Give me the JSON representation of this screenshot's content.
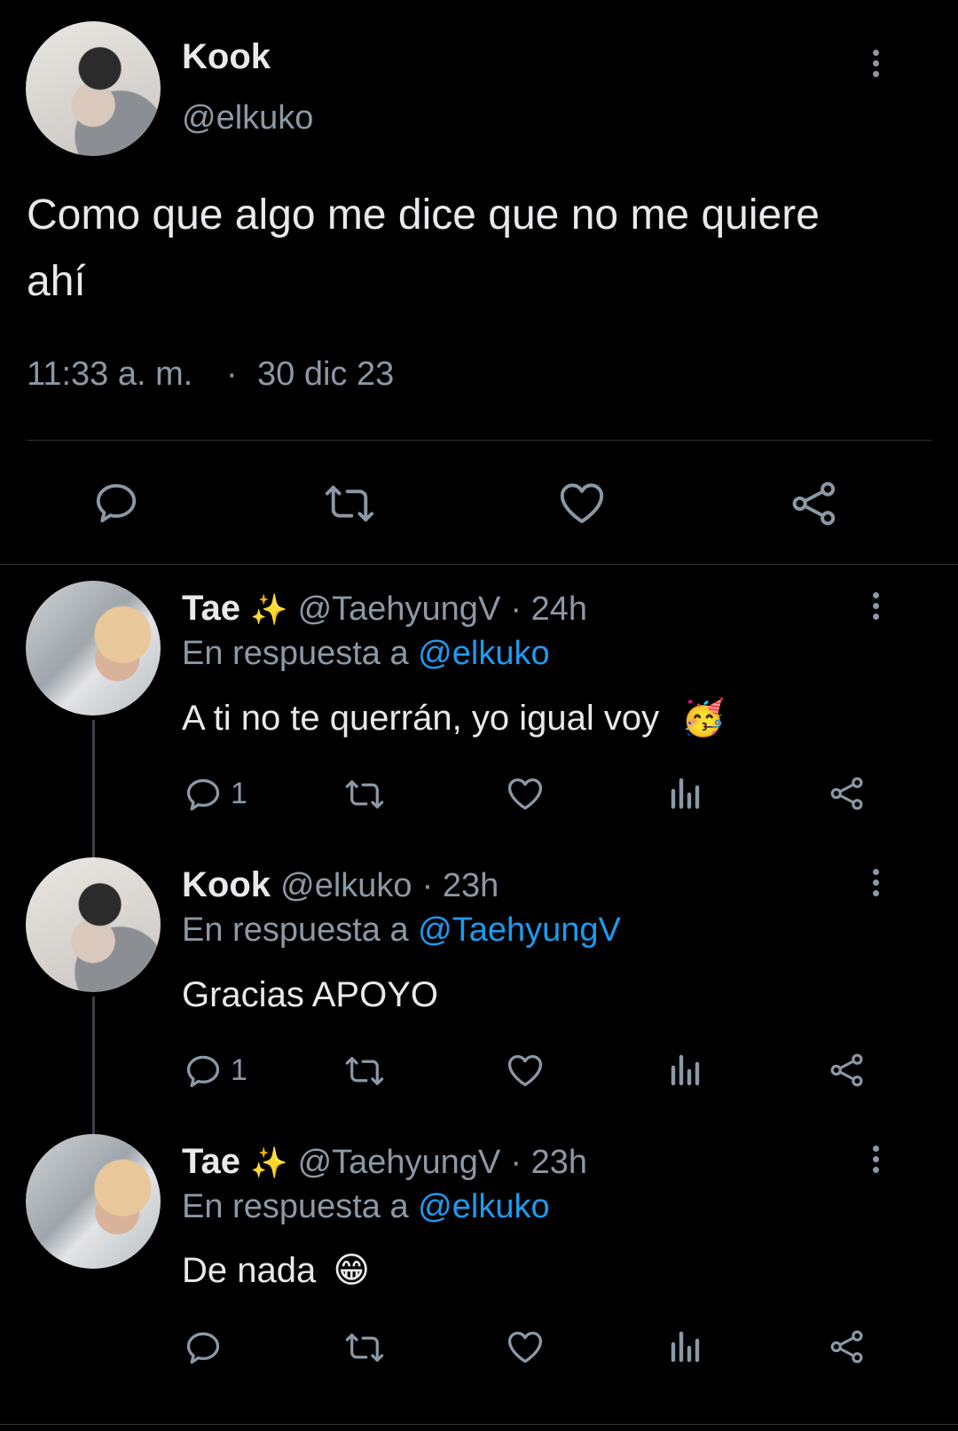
{
  "main_tweet": {
    "author_name": "Kook",
    "author_handle": "@elkuko",
    "text_line1": "Como que algo me dice que no me quiere",
    "text_line2": "ahí",
    "time": "11:33 a. m.",
    "separator": "·",
    "date": "30 dic 23"
  },
  "replies": [
    {
      "name": "Tae",
      "name_emoji": "✨",
      "handle": "@TaehyungV",
      "age": "· 24h",
      "reply_prefix": "En respuesta a",
      "reply_to": "@elkuko",
      "text": "A ti no te querrán, yo igual voy",
      "text_emoji": "🥳",
      "reply_count": "1"
    },
    {
      "name": "Kook",
      "name_emoji": "",
      "handle": "@elkuko",
      "age": "· 23h",
      "reply_prefix": "En respuesta a",
      "reply_to": "@TaehyungV",
      "text": "Gracias APOYO",
      "text_emoji": "",
      "reply_count": "1"
    },
    {
      "name": "Tae",
      "name_emoji": "✨",
      "handle": "@TaehyungV",
      "age": "· 23h",
      "reply_prefix": "En respuesta a",
      "reply_to": "@elkuko",
      "text": "De nada",
      "text_emoji": "😁",
      "reply_count": ""
    }
  ],
  "colors": {
    "background": "#000000",
    "text": "#e7e9ea",
    "muted": "#8b98a5",
    "link": "#1d9bf0",
    "divider": "#2f3336"
  }
}
